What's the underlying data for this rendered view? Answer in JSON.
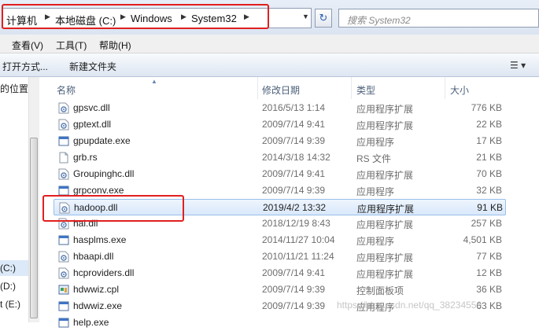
{
  "address": {
    "crumbs": [
      "计算机",
      "本地磁盘 (C:)",
      "Windows",
      "System32"
    ],
    "search_placeholder": "搜索 System32"
  },
  "menu": [
    "查看(V)",
    "工具(T)",
    "帮助(H)"
  ],
  "toolbar": {
    "open_with": "打开方式...",
    "new_folder": "新建文件夹"
  },
  "nav": {
    "location": "的位置",
    "drive_c": "(C:)",
    "drive_d": "(D:)",
    "drive_e": "t (E:)"
  },
  "columns": {
    "name": "名称",
    "date": "修改日期",
    "type": "类型",
    "size": "大小"
  },
  "files": [
    {
      "name": "gpsvc.dll",
      "date": "2016/5/13 1:14",
      "type": "应用程序扩展",
      "size": "776 KB",
      "icon": "dll-icon"
    },
    {
      "name": "gptext.dll",
      "date": "2009/7/14 9:41",
      "type": "应用程序扩展",
      "size": "22 KB",
      "icon": "dll-icon"
    },
    {
      "name": "gpupdate.exe",
      "date": "2009/7/14 9:39",
      "type": "应用程序",
      "size": "17 KB",
      "icon": "exe-icon"
    },
    {
      "name": "grb.rs",
      "date": "2014/3/18 14:32",
      "type": "RS 文件",
      "size": "21 KB",
      "icon": "file-icon"
    },
    {
      "name": "Groupinghc.dll",
      "date": "2009/7/14 9:41",
      "type": "应用程序扩展",
      "size": "70 KB",
      "icon": "dll-icon"
    },
    {
      "name": "grpconv.exe",
      "date": "2009/7/14 9:39",
      "type": "应用程序",
      "size": "32 KB",
      "icon": "exe-icon"
    },
    {
      "name": "hadoop.dll",
      "date": "2019/4/2 13:32",
      "type": "应用程序扩展",
      "size": "91 KB",
      "icon": "dll-icon"
    },
    {
      "name": "hal.dll",
      "date": "2018/12/19 8:43",
      "type": "应用程序扩展",
      "size": "257 KB",
      "icon": "dll-icon"
    },
    {
      "name": "hasplms.exe",
      "date": "2014/11/27 10:04",
      "type": "应用程序",
      "size": "4,501 KB",
      "icon": "exe-icon"
    },
    {
      "name": "hbaapi.dll",
      "date": "2010/11/21 11:24",
      "type": "应用程序扩展",
      "size": "77 KB",
      "icon": "dll-icon"
    },
    {
      "name": "hcproviders.dll",
      "date": "2009/7/14 9:41",
      "type": "应用程序扩展",
      "size": "12 KB",
      "icon": "dll-icon"
    },
    {
      "name": "hdwwiz.cpl",
      "date": "2009/7/14 9:39",
      "type": "控制面板项",
      "size": "36 KB",
      "icon": "cpl-icon"
    },
    {
      "name": "hdwwiz.exe",
      "date": "2009/7/14 9:39",
      "type": "应用程序",
      "size": "63 KB",
      "icon": "exe-icon"
    },
    {
      "name": "help.exe",
      "date": "",
      "type": "",
      "size": "",
      "icon": "exe-icon"
    }
  ],
  "selected_index": 6,
  "watermark": "https://blog.csdn.net/qq_38234550"
}
